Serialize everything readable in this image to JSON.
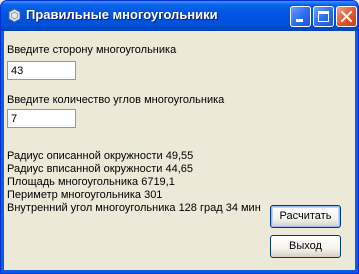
{
  "window": {
    "title": "Правильные многоугольники"
  },
  "form": {
    "side_label": "Введите сторону многоугольника",
    "side_value": "43",
    "angles_label": "Введите количество углов многоугольника",
    "angles_value": "7"
  },
  "results": [
    "Радиус описанной окружности  49,55",
    "Радиус вписанной окружности  44,65",
    "Площадь многоугольника  6719,1",
    "Периметр многоугольника  301",
    "Внутренний угол многоугольника 128 град  34  мин"
  ],
  "buttons": {
    "calculate": "Расчитать",
    "exit": "Выход"
  },
  "icons": {
    "app": "polygon-app-icon",
    "minimize": "minimize-icon",
    "maximize": "maximize-icon",
    "close": "close-icon"
  },
  "colors": {
    "titlebar": "#0054e3",
    "close_button": "#e25a33",
    "client_background": "#ece9d8"
  }
}
